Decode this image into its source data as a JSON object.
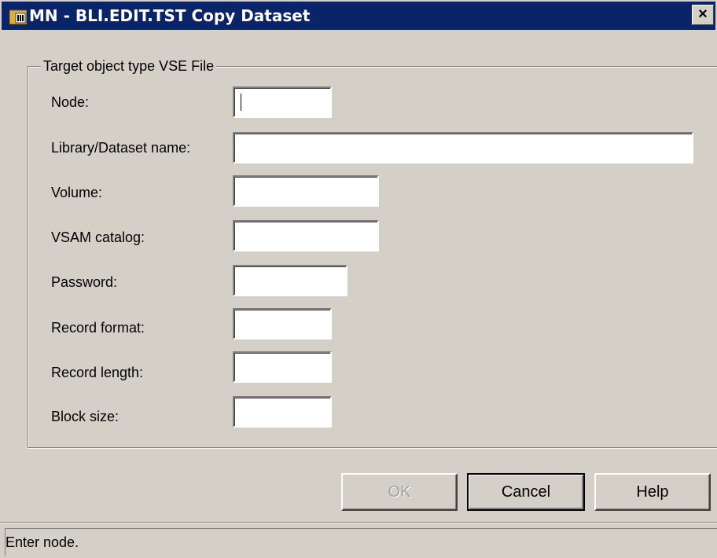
{
  "window": {
    "title": "MN - BLI.EDIT.TST Copy Dataset",
    "title_icon": "app-icon",
    "close_label": "×",
    "titlebar_color": "#0a246a"
  },
  "group": {
    "legend": "Target object type VSE File"
  },
  "fields": [
    {
      "label": "Node:",
      "value": ""
    },
    {
      "label": "Library/Dataset name:",
      "value": ""
    },
    {
      "label": "Volume:",
      "value": ""
    },
    {
      "label": "VSAM catalog:",
      "value": ""
    },
    {
      "label": "Password:",
      "value": ""
    },
    {
      "label": "Record format:",
      "value": ""
    },
    {
      "label": "Record length:",
      "value": ""
    },
    {
      "label": "Block size:",
      "value": ""
    }
  ],
  "buttons": {
    "ok": "OK",
    "cancel": "Cancel",
    "help": "Help"
  },
  "status": {
    "text": "Enter node."
  }
}
